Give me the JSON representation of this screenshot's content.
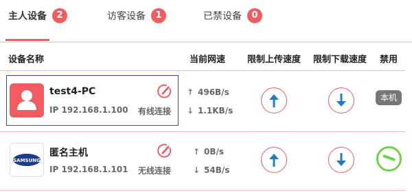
{
  "tabs": [
    {
      "label": "主人设备",
      "count": "2"
    },
    {
      "label": "访客设备",
      "count": "1"
    },
    {
      "label": "已禁设备",
      "count": "0"
    }
  ],
  "columns": {
    "device_name": "设备名称",
    "current_speed": "当前网速",
    "limit_upload": "限制上传速度",
    "limit_download": "限制下载速度",
    "ban": "禁用"
  },
  "devices": [
    {
      "name": "test4-PC",
      "ip": "IP 192.168.1.100",
      "connection": "有线连接",
      "up_speed": "496B/s",
      "down_speed": "1.1KB/s",
      "icon": "user-avatar-icon",
      "ban": "本机"
    },
    {
      "name": "匿名主机",
      "ip": "IP 192.168.1.101",
      "connection": "无线连接",
      "up_speed": "0B/s",
      "down_speed": "54B/s",
      "icon": "samsung-logo",
      "logo_text": "SAMSUNG"
    }
  ],
  "colors": {
    "accent": "#f25c60",
    "ban_green": "#6dd14a",
    "upload_blue": "#1e7bc4",
    "select_border": "#3a46c9"
  }
}
